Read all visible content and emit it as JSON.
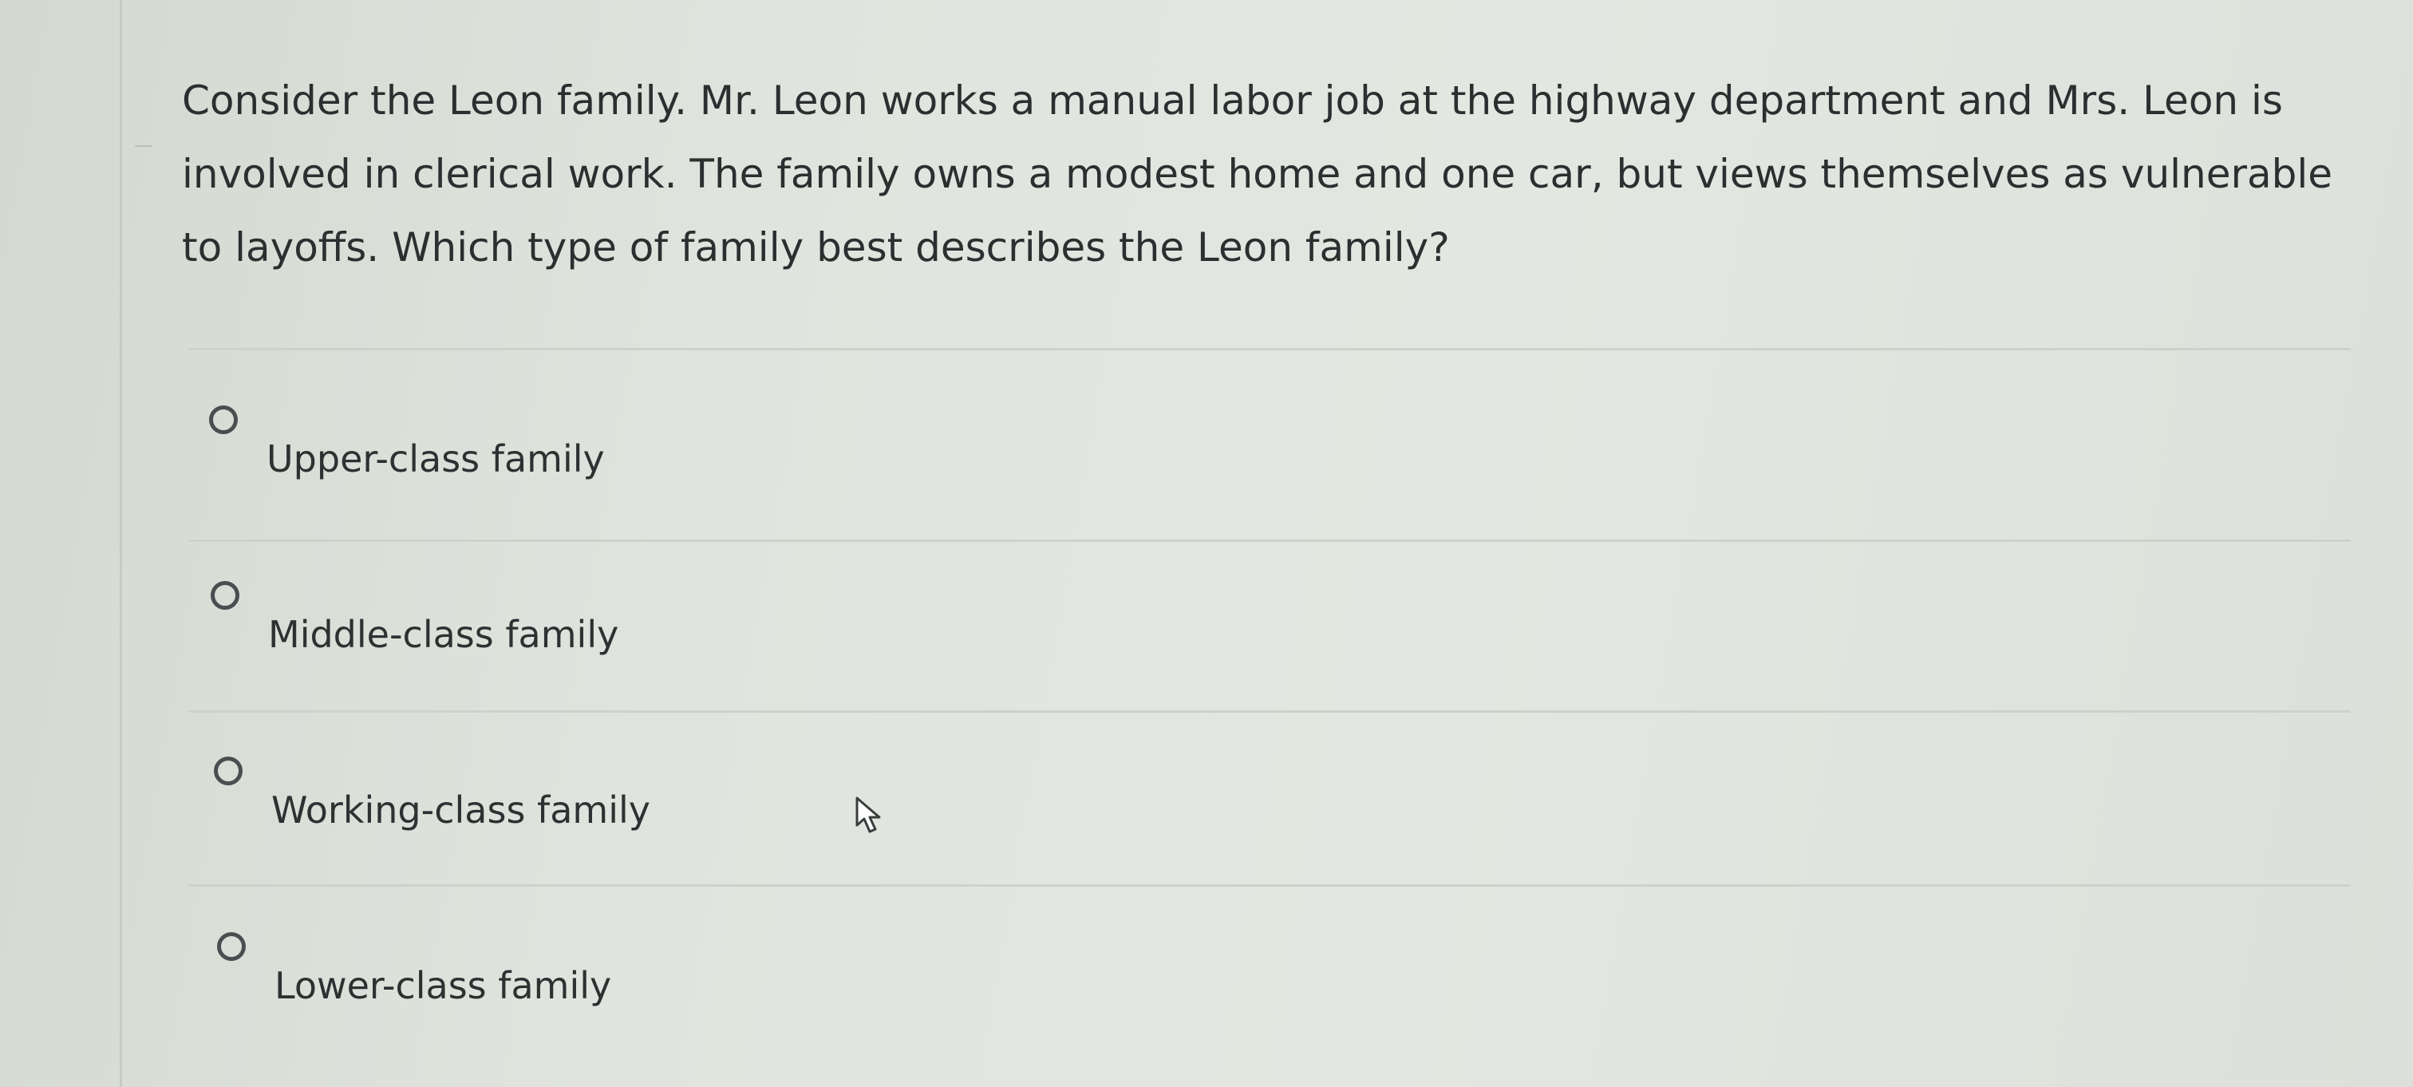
{
  "question": {
    "text": "Consider the Leon family. Mr. Leon works a manual labor job at the highway department and Mrs. Leon is involved in clerical work. The family owns a modest home and one car, but views themselves as vulnerable to layoffs. Which type of family best describes the Leon family?"
  },
  "options": [
    {
      "label": "Upper-class family",
      "selected": false
    },
    {
      "label": "Middle-class family",
      "selected": false
    },
    {
      "label": "Working-class family",
      "selected": false
    },
    {
      "label": "Lower-class family",
      "selected": false
    }
  ],
  "icons": {
    "radio": "radio-button-icon",
    "cursor": "mouse-pointer-icon"
  },
  "colors": {
    "background": "#e2e5df",
    "text": "#2e3131",
    "divider": "#cdd2cb",
    "radio_border": "#4a4e50"
  }
}
